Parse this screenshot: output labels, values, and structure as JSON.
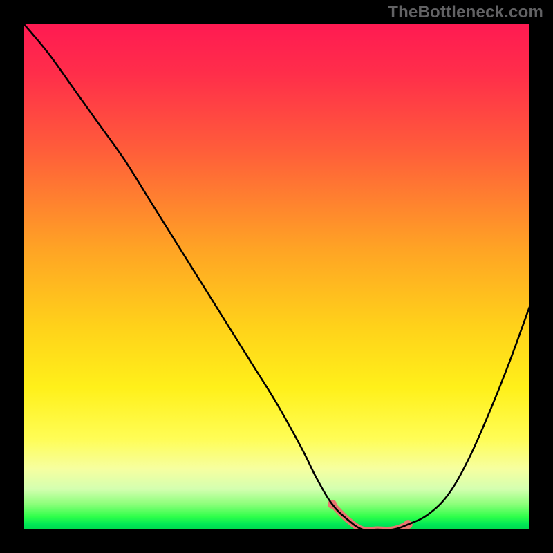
{
  "watermark": "TheBottleneck.com",
  "chart_data": {
    "type": "line",
    "title": "",
    "xlabel": "",
    "ylabel": "",
    "xlim": [
      0,
      100
    ],
    "ylim": [
      0,
      100
    ],
    "grid": false,
    "legend": false,
    "background_gradient": {
      "direction": "vertical",
      "stops": [
        {
          "pos": 0,
          "color": "#ff1a52"
        },
        {
          "pos": 25,
          "color": "#ff5d3a"
        },
        {
          "pos": 60,
          "color": "#ffd21a"
        },
        {
          "pos": 85,
          "color": "#f6ffa0"
        },
        {
          "pos": 100,
          "color": "#00d84e"
        }
      ]
    },
    "series": [
      {
        "name": "bottleneck-curve",
        "color": "#000000",
        "x": [
          0,
          5,
          10,
          15,
          20,
          25,
          30,
          35,
          40,
          45,
          50,
          55,
          58,
          61,
          64,
          67,
          70,
          73,
          76,
          80,
          84,
          88,
          92,
          96,
          100
        ],
        "y": [
          100,
          94,
          87,
          80,
          73,
          65,
          57,
          49,
          41,
          33,
          25,
          16,
          10,
          5,
          2,
          0,
          0,
          0,
          1,
          3,
          7,
          14,
          23,
          33,
          44
        ]
      }
    ],
    "highlight_segment": {
      "name": "optimal-range",
      "color": "#e9746f",
      "x": [
        61,
        64,
        67,
        70,
        73,
        76
      ],
      "y": [
        5,
        2,
        0,
        0,
        0,
        1
      ],
      "endpoints": [
        {
          "x": 61,
          "y": 5
        },
        {
          "x": 76,
          "y": 1
        }
      ]
    }
  }
}
